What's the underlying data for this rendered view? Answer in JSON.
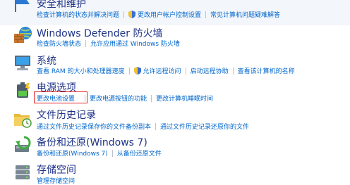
{
  "categories": [
    {
      "key": "security",
      "title": "安全和维护",
      "icon": "security-flag-icon",
      "links": [
        {
          "label": "检查计算机的状态并解决问题",
          "shield": false
        },
        {
          "label": "更改用户帐户控制设置",
          "shield": true
        },
        {
          "label": "常见计算机问题疑难解答",
          "shield": false
        }
      ]
    },
    {
      "key": "firewall",
      "title": "Windows Defender 防火墙",
      "icon": "firewall-icon",
      "links": [
        {
          "label": "检查防火墙状态",
          "shield": false
        },
        {
          "label": "允许应用通过 Windows 防火墙",
          "shield": false
        }
      ]
    },
    {
      "key": "system",
      "title": "系统",
      "icon": "computer-icon",
      "links": [
        {
          "label": "查看 RAM 的大小和处理器速度",
          "shield": false
        },
        {
          "label": "允许远程访问",
          "shield": true
        },
        {
          "label": "启动远程协助",
          "shield": false
        },
        {
          "label": "查看该计算机的名称",
          "shield": false
        }
      ]
    },
    {
      "key": "power",
      "title": "电源选项",
      "icon": "battery-icon",
      "links": [
        {
          "label": "更改电池设置",
          "shield": false
        },
        {
          "label": "更改电源按钮的功能",
          "shield": false
        },
        {
          "label": "更改计算机睡眠时间",
          "shield": false
        }
      ]
    },
    {
      "key": "filehistory",
      "title": "文件历史记录",
      "icon": "folder-clock-icon",
      "links": [
        {
          "label": "通过文件历史记录保存你的文件备份副本",
          "shield": false
        },
        {
          "label": "通过文件历史记录还原你的文件",
          "shield": false
        }
      ]
    },
    {
      "key": "backup",
      "title": "备份和还原(Windows 7)",
      "icon": "backup-restore-icon",
      "links": [
        {
          "label": "备份和还原(Windows 7)",
          "shield": false
        },
        {
          "label": "从备份还原文件",
          "shield": false
        }
      ]
    },
    {
      "key": "storage",
      "title": "存储空间",
      "icon": "storage-drives-icon",
      "links": [
        {
          "label": "管理存储空间",
          "shield": false
        }
      ]
    }
  ],
  "colors": {
    "title": "#1e3287",
    "link": "#0066cc",
    "highlight_border": "#e3262b"
  }
}
